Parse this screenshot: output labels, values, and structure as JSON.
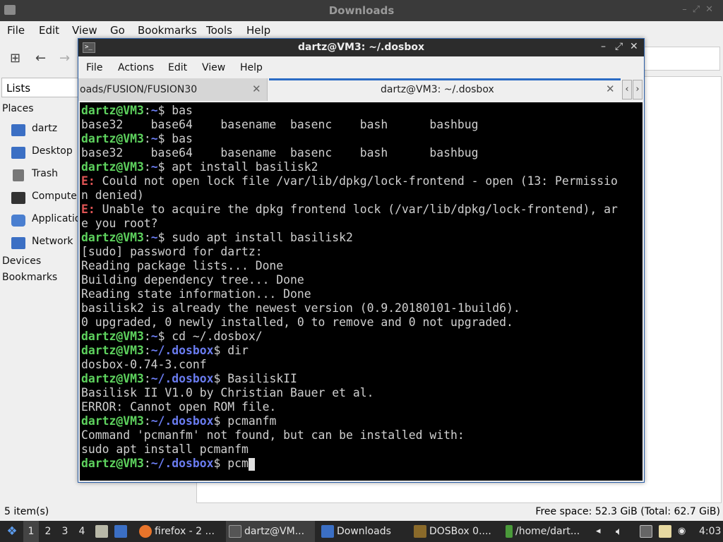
{
  "file_manager": {
    "title": "Downloads",
    "menu": [
      "File",
      "Edit",
      "View",
      "Go",
      "Bookmarks",
      "Tools",
      "Help"
    ],
    "side_combo": "Lists",
    "places_header": "Places",
    "places": [
      {
        "label": "dartz",
        "icon": "home-folder-icon",
        "color": "#3b6fc4"
      },
      {
        "label": "Desktop",
        "icon": "desktop-icon",
        "color": "#3b6fc4"
      },
      {
        "label": "Trash",
        "icon": "trash-icon",
        "color": "#777777"
      },
      {
        "label": "Computer",
        "icon": "computer-icon",
        "color": "#333333"
      },
      {
        "label": "Applications",
        "icon": "applications-icon",
        "color": "#4a7fd0"
      },
      {
        "label": "Network",
        "icon": "network-icon",
        "color": "#3b6fc4"
      }
    ],
    "devices_header": "Devices",
    "bookmarks_header": "Bookmarks",
    "status_left": "5 item(s)",
    "status_right": "Free space: 52.3 GiB (Total: 62.7 GiB)"
  },
  "terminal": {
    "title": "dartz@VM3: ~/.dosbox",
    "menu": [
      "File",
      "Actions",
      "Edit",
      "View",
      "Help"
    ],
    "tabs": [
      {
        "label": "oads/FUSION/FUSION30",
        "active": false
      },
      {
        "label": "dartz@VM3: ~/.dosbox",
        "active": true
      }
    ],
    "prompt_user": "dartz@VM3",
    "lines": [
      {
        "kind": "prompt",
        "path": "~",
        "cmd": " bas"
      },
      {
        "kind": "out",
        "text": "base32    base64    basename  basenc    bash      bashbug"
      },
      {
        "kind": "prompt",
        "path": "~",
        "cmd": " bas"
      },
      {
        "kind": "out",
        "text": "base32    base64    basename  basenc    bash      bashbug"
      },
      {
        "kind": "prompt",
        "path": "~",
        "cmd": " apt install basilisk2"
      },
      {
        "kind": "err",
        "text": " Could not open lock file /var/lib/dpkg/lock-frontend - open (13: Permissio"
      },
      {
        "kind": "out",
        "text": "n denied)"
      },
      {
        "kind": "err",
        "text": " Unable to acquire the dpkg frontend lock (/var/lib/dpkg/lock-frontend), ar"
      },
      {
        "kind": "out",
        "text": "e you root?"
      },
      {
        "kind": "prompt",
        "path": "~",
        "cmd": " sudo apt install basilisk2"
      },
      {
        "kind": "out",
        "text": "[sudo] password for dartz:"
      },
      {
        "kind": "out",
        "text": "Reading package lists... Done"
      },
      {
        "kind": "out",
        "text": "Building dependency tree... Done"
      },
      {
        "kind": "out",
        "text": "Reading state information... Done"
      },
      {
        "kind": "out",
        "text": "basilisk2 is already the newest version (0.9.20180101-1build6)."
      },
      {
        "kind": "out",
        "text": "0 upgraded, 0 newly installed, 0 to remove and 0 not upgraded."
      },
      {
        "kind": "prompt",
        "path": "~",
        "cmd": " cd ~/.dosbox/"
      },
      {
        "kind": "prompt",
        "path": "~/.dosbox",
        "cmd": " dir"
      },
      {
        "kind": "out",
        "text": "dosbox-0.74-3.conf"
      },
      {
        "kind": "prompt",
        "path": "~/.dosbox",
        "cmd": " BasiliskII"
      },
      {
        "kind": "out",
        "text": "Basilisk II V1.0 by Christian Bauer et al."
      },
      {
        "kind": "out",
        "text": "ERROR: Cannot open ROM file."
      },
      {
        "kind": "prompt",
        "path": "~/.dosbox",
        "cmd": " pcmanfm"
      },
      {
        "kind": "out",
        "text": "Command 'pcmanfm' not found, but can be installed with:"
      },
      {
        "kind": "out",
        "text": "sudo apt install pcmanfm"
      },
      {
        "kind": "prompt",
        "path": "~/.dosbox",
        "cmd": " pcm",
        "cursor": true
      }
    ],
    "err_prefix": "E:",
    "colors": {
      "user": "#5ed35e",
      "path": "#6a7cf0",
      "error": "#e05555"
    }
  },
  "taskbar": {
    "workspaces": [
      "1",
      "2",
      "3",
      "4"
    ],
    "tasks": [
      {
        "label": "firefox - 2 ...",
        "icon": "firefox-icon",
        "color": "#e8742a"
      },
      {
        "label": "dartz@VM...",
        "icon": "terminal-icon",
        "color": "#555555"
      },
      {
        "label": "Downloads",
        "icon": "folder-icon",
        "color": "#3b6fc4"
      },
      {
        "label": "DOSBox 0....",
        "icon": "dosbox-icon",
        "color": "#8a6a2a"
      },
      {
        "label": "/home/dart...",
        "icon": "editor-icon",
        "color": "#4a9a3a"
      }
    ],
    "clock": "4:03"
  }
}
